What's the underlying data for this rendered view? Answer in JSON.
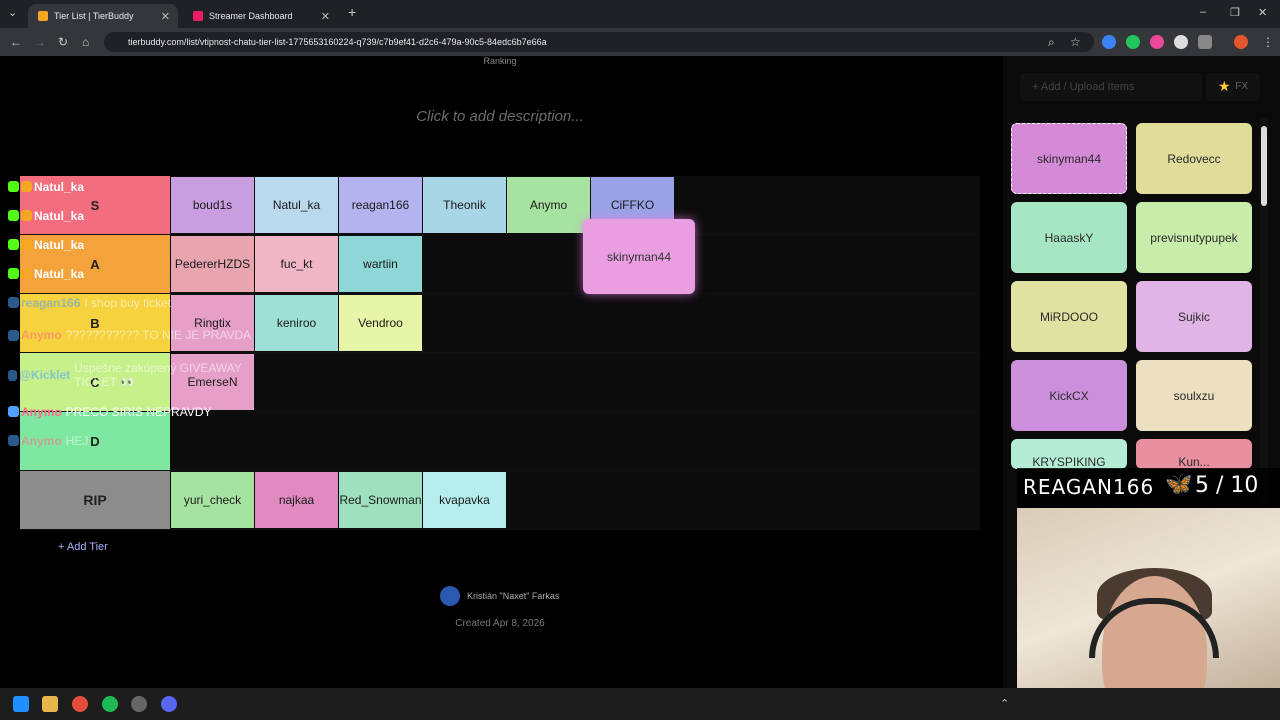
{
  "browser": {
    "tabs": [
      {
        "title": "Tier List | TierBuddy",
        "active": true
      },
      {
        "title": "Streamer Dashboard",
        "active": false
      }
    ],
    "url": "tierbuddy.com/list/vtipnost-chatu-tier-list-1775653160224-q739/c7b9ef41-d2c6-479a-90c5-84edc6b7e66a"
  },
  "page": {
    "ranking_label": "Ranking",
    "description_placeholder": "Click to add description...",
    "add_tier_label": "Add Tier",
    "author": "Kristián \"Naxet\" Farkas",
    "created": "Created Apr 8, 2026"
  },
  "tiers": [
    {
      "label": "S",
      "color": "#f26d7d",
      "items": [
        {
          "name": "boud1s",
          "color": "#c99ee0"
        },
        {
          "name": "Natul_ka",
          "color": "#b9d9ec"
        },
        {
          "name": "reagan166",
          "color": "#b5b2f0"
        },
        {
          "name": "Theonik",
          "color": "#a9d6e6"
        },
        {
          "name": "Anymo",
          "color": "#a6e3a1"
        },
        {
          "name": "CiFFKO",
          "color": "#9aa3e8"
        }
      ]
    },
    {
      "label": "A",
      "color": "#f4a23c",
      "items": [
        {
          "name": "PedererHZDS",
          "color": "#e8a5b0"
        },
        {
          "name": "fuc_kt",
          "color": "#f0b6c6"
        },
        {
          "name": "wartiin",
          "color": "#8fd6d6"
        }
      ]
    },
    {
      "label": "B",
      "color": "#f5d23e",
      "items": [
        {
          "name": "Ringtix",
          "color": "#e6a0c8"
        },
        {
          "name": "keniroo",
          "color": "#9ee0d6"
        },
        {
          "name": "Vendroo",
          "color": "#e6f5a8"
        }
      ]
    },
    {
      "label": "C",
      "color": "#c6f08a",
      "items": [
        {
          "name": "EmerseN",
          "color": "#e6a0c8"
        }
      ]
    },
    {
      "label": "D",
      "color": "#7ee8a0",
      "items": []
    },
    {
      "label": "RIP",
      "color": "#8c8c8c",
      "items": [
        {
          "name": "yuri_check",
          "color": "#a6e3a1"
        },
        {
          "name": "najkaa",
          "color": "#e08ac0"
        },
        {
          "name": "Red_Snowman",
          "color": "#9ee0c0"
        },
        {
          "name": "kvapavka",
          "color": "#b5ecec"
        }
      ]
    }
  ],
  "dragging_item": "skinyman44",
  "chat": [
    {
      "user": "Natul_ka",
      "text": "",
      "user_color": "#ffffff"
    },
    {
      "user": "Natul_ka",
      "text": "",
      "user_color": "#ffffff"
    },
    {
      "user": "Natul_ka",
      "text": "",
      "user_color": "#ffffff"
    },
    {
      "user": "Natul_ka",
      "text": "",
      "user_color": "#ffffff"
    },
    {
      "user": "reagan166",
      "text": "I shop buy ticket",
      "user_color": "#4fa3ff"
    },
    {
      "user": "Anymo",
      "text": "??????????? TO NIE JE PRAVDA",
      "user_color": "#ff6b8a"
    },
    {
      "user": "@Kicklet",
      "text": "Úspešne zakúpený GIVEAWAY TICKET 👀",
      "user_color": "#4fa3ff"
    },
    {
      "user": "Anymo",
      "text": "PRECO SIRIS NEPRAVDY",
      "user_color": "#ff6b8a"
    },
    {
      "user": "Anymo",
      "text": "HEJ",
      "user_color": "#ff6b8a"
    }
  ],
  "panel": {
    "add_upload_label": "Add / Upload Items",
    "fx_label": "FX",
    "items": [
      {
        "name": "skinyman44",
        "color": "#d58ad8"
      },
      {
        "name": "Redovecc",
        "color": "#e0dc9a"
      },
      {
        "name": "HaaaskY",
        "color": "#a6e6c4"
      },
      {
        "name": "previsnutypupek",
        "color": "#c8ecaa"
      },
      {
        "name": "MiRDOOO",
        "color": "#dfe2a0"
      },
      {
        "name": "Sujkic",
        "color": "#e0b5e6"
      },
      {
        "name": "KickCX",
        "color": "#cc8fdc"
      },
      {
        "name": "soulxzu",
        "color": "#ece0c0"
      },
      {
        "name": "KRYSPIKING",
        "color": "#b5ecd6"
      },
      {
        "name": "Kun...",
        "color": "#e88fa0"
      }
    ]
  },
  "stream_overlay": {
    "streamer_name": "REAGAN166",
    "count": "5 / 10"
  }
}
